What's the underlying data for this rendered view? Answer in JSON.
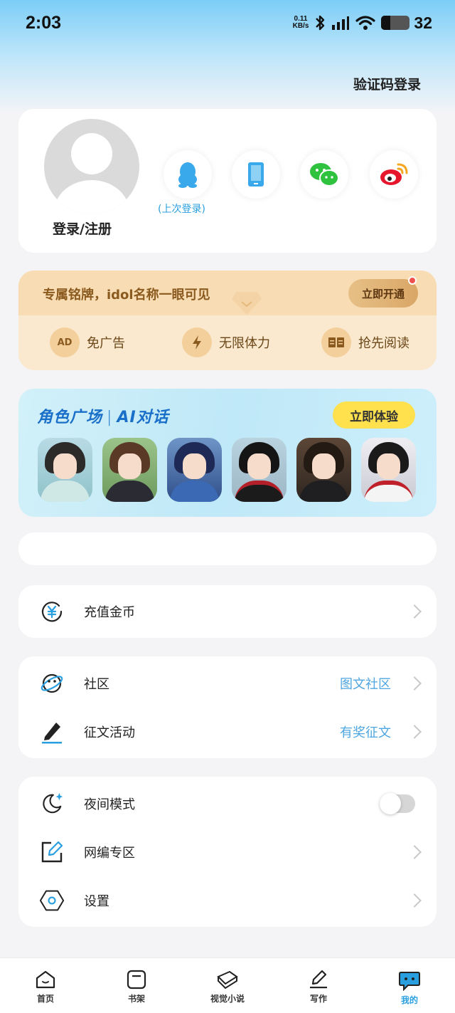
{
  "status_bar": {
    "time": "2:03",
    "net_speed_value": "0.11",
    "net_speed_unit": "KB/s",
    "battery_level": "32"
  },
  "header": {
    "sms_login": "验证码登录"
  },
  "login_card": {
    "login_label": "登录/注册",
    "last_login_hint": "(上次登录)",
    "social_icons": [
      "qq-icon",
      "phone-icon",
      "wechat-icon",
      "weibo-icon"
    ]
  },
  "vip": {
    "title": "专属铭牌，idol名称一眼可见",
    "button": "立即开通",
    "features": [
      "免广告",
      "无限体力",
      "抢先阅读"
    ],
    "ad_icon_text": "AD"
  },
  "role_banner": {
    "title_left": "角色广场",
    "title_right": "AI对话",
    "button": "立即体验"
  },
  "menu": {
    "recharge": "充值金币",
    "community": "社区",
    "community_hint": "图文社区",
    "contest": "征文活动",
    "contest_hint": "有奖征文",
    "night_mode": "夜间模式",
    "editor_zone": "网编专区",
    "settings": "设置"
  },
  "tabs": [
    "首页",
    "书架",
    "视觉小说",
    "写作",
    "我的"
  ],
  "colors": {
    "accent": "#2a9fe0",
    "vip_text": "#8a5a1f",
    "role_button": "#ffe04d"
  }
}
